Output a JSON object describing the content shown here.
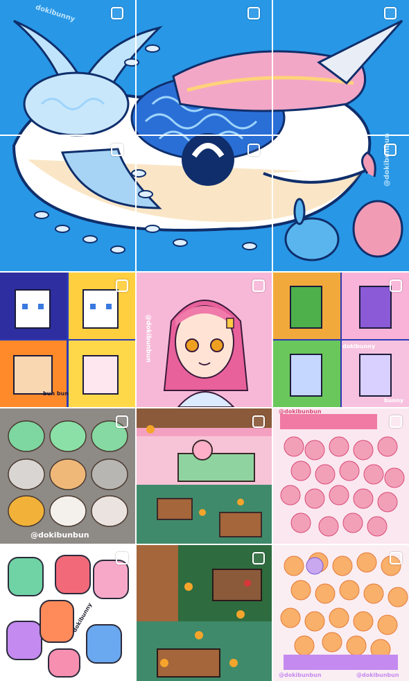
{
  "grid": {
    "watermarks": {
      "whale_top_left": "dokibunny",
      "whale_bottom_right": "@dokibunbun",
      "portrait_side": "@dokibunbun",
      "pixel_pets_corner": "dokibunny",
      "pixel_pets_bottom": "bunny",
      "pets_bottom_left": "bun bun",
      "clay_caption": "@dokibunbun",
      "stickers_side": "dokibunny",
      "ghost_top": "@dokibunbun",
      "peach_bottom_left": "@dokibunbun",
      "peach_bottom_right": "@dokibunbun"
    },
    "colors": {
      "whale_bg": "#1f8fe0",
      "portrait_bg": "#f7b8d8",
      "pixel_pets_bg": "#2a3ab8",
      "clay_bg": "#8e8a86",
      "cafe_bg": "#f4a0c0",
      "ghost_bg": "#fbe7ef",
      "stickers_bg": "#ffffff",
      "garden_bg": "#2e6b3e",
      "peach_bg": "#fbeef2"
    },
    "icons": [
      "multi-select-icon"
    ]
  }
}
